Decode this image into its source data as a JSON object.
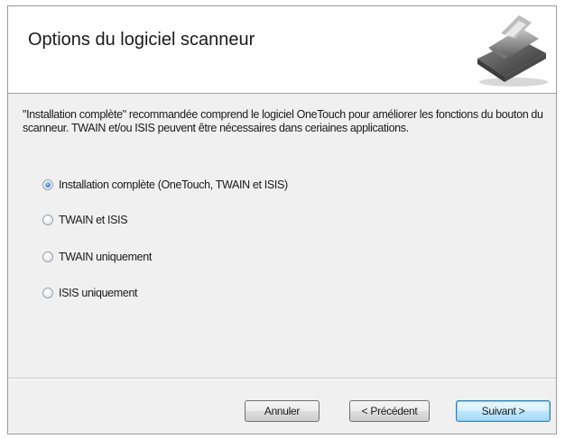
{
  "window": {
    "title": "Options du logiciel scanneur",
    "header_icon": "scanner-icon"
  },
  "description": "\"Installation complète\" recommandée comprend le logiciel OneTouch pour améliorer les fonctions du bouton du scanneur. TWAIN et/ou ISIS peuvent être nécessaires dans ceriaines applications.",
  "options": [
    {
      "label": "Installation complète (OneTouch, TWAIN et ISIS)",
      "selected": true
    },
    {
      "label": "TWAIN et ISIS",
      "selected": false
    },
    {
      "label": "TWAIN uniquement",
      "selected": false
    },
    {
      "label": "ISIS uniquement",
      "selected": false
    }
  ],
  "buttons": {
    "cancel_label": "Annuler",
    "prev_label": "< Précédent",
    "next_label": "Suivant >"
  },
  "colors": {
    "header_bg": "#ffffff",
    "dialog_bg": "#f0f0f0",
    "radio_selected": "#2a7bd1",
    "default_button_border": "#3c7fb1"
  }
}
